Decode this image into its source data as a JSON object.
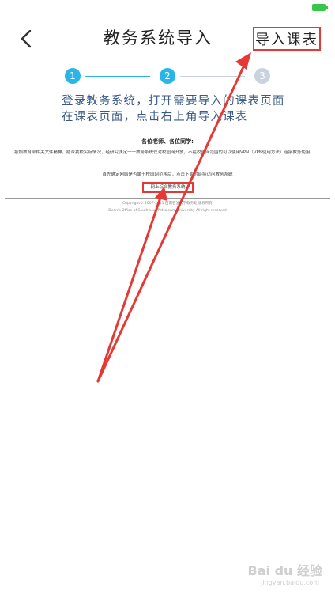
{
  "header": {
    "title": "教务系统导入",
    "import_label": "导入课表"
  },
  "stepper": {
    "steps": [
      "1",
      "2",
      "3"
    ],
    "active_color": "#29b6e6",
    "inactive_color": "#c9d3e0"
  },
  "instruction": {
    "line1": "登录教务系统，打开需要导入的课表页面",
    "line2": "在课表页面，点击右上角导入课表"
  },
  "webpage": {
    "heading": "各位老师、各位同学:",
    "paragraph": "按照教育部相关文件精神，结合我校实际情况，经研究决定一一教务系统仅对校园网开放，不在校园网范围的可以使用VPN（VPN使用方法）连接教务使用。",
    "note": "首先确定网络是否属于校园网范围后，点击下面的链接访问教务系统",
    "link": "网上综合教务系统",
    "footer1": "Copyright© 2007-2011 西南石油大学教务处 版权所有",
    "footer2": "Dean's Office of Southwest Petroleum University All right reserved"
  },
  "watermark": {
    "brand": "Bai du 经验",
    "sub": "jingyan.baidu.com"
  },
  "colors": {
    "highlight": "#e53935",
    "accent": "#29b6e6"
  }
}
